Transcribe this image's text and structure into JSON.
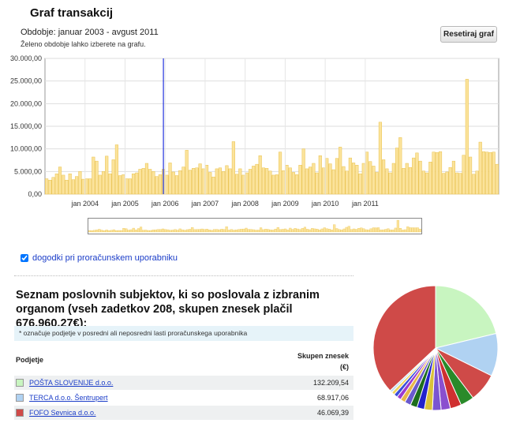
{
  "page": {
    "title": "Graf transakcij",
    "period": "Obdobje: januar 2003 - avgust 2011",
    "hint": "Želeno obdobje lahko izberete na grafu.",
    "reset_label": "Resetiraj graf",
    "checkbox_label": "dogodki pri proračunskem uporabniku",
    "list_heading": "Seznam poslovnih subjektov, ki so poslovala z izbranim organom (vseh zadetkov 208, skupen znesek plačil 676.960,27€):",
    "note": "* označuje podjetje v posredni ali neposredni lasti proračunskega uporabnika",
    "col_company": "Podjetje",
    "col_amount_line1": "Skupen znesek",
    "col_amount_line2": "(€)"
  },
  "rows": [
    {
      "name": "POŠTA SLOVENIJE d.o.o.",
      "amount": "132.209,54",
      "color": "#c8f5c0"
    },
    {
      "name": "TERCA d.o.o. Šentrupert",
      "amount": "68.917,06",
      "color": "#b0d2f2"
    },
    {
      "name": "FOFO Sevnica d.o.o.",
      "amount": "46.069,39",
      "color": "#cf4a48"
    }
  ],
  "chart_data": {
    "type": "bar",
    "x_start": "2003-01",
    "xtick_labels": [
      "jan 2004",
      "jan 2005",
      "jan 2006",
      "jan 2007",
      "jan 2008",
      "jan 2009",
      "jan 2010",
      "jan 2011"
    ],
    "ytick_labels": [
      "0,00",
      "5.000,00",
      "10.000,00",
      "15.000,00",
      "20.000,00",
      "25.000,00",
      "30.000,00"
    ],
    "ylim": [
      0,
      30000
    ],
    "grid": true,
    "bar_color": "#fbe39b",
    "bar_edge": "#e9c04a",
    "marker_month": "2005-12",
    "marker_color": "#2233dd",
    "values": [
      3400,
      3100,
      3700,
      4500,
      6000,
      4200,
      3100,
      4500,
      3200,
      3900,
      5000,
      3300,
      3400,
      3400,
      8200,
      7300,
      4200,
      5000,
      8400,
      4500,
      7600,
      10900,
      4100,
      4300,
      3400,
      3400,
      4500,
      4700,
      5500,
      5700,
      6800,
      5500,
      5000,
      3900,
      4300,
      5500,
      4200,
      6900,
      4900,
      4100,
      5200,
      6000,
      9700,
      5300,
      5700,
      5800,
      6700,
      5600,
      6400,
      4800,
      3800,
      5600,
      5800,
      5000,
      6300,
      5600,
      11600,
      4400,
      5600,
      4200,
      4700,
      5500,
      6200,
      6600,
      8500,
      5800,
      5700,
      5100,
      4200,
      4300,
      9300,
      5200,
      6400,
      5800,
      4800,
      4300,
      6400,
      10000,
      5600,
      6000,
      6800,
      4700,
      8500,
      5800,
      7900,
      6700,
      5400,
      7900,
      10400,
      6100,
      5100,
      8000,
      6900,
      6400,
      4500,
      6800,
      9300,
      7200,
      6200,
      4800,
      15900,
      7600,
      5600,
      4700,
      6800,
      10200,
      12500,
      5700,
      6800,
      5900,
      8000,
      9100,
      7300,
      5100,
      4700,
      7100,
      9300,
      9200,
      9400,
      4600,
      4900,
      5900,
      7300,
      4700,
      4600,
      8600,
      25400,
      8200,
      4400,
      5100,
      11500,
      9400,
      9300,
      9200,
      9300,
      6600
    ],
    "pie_colors": [
      "#c8f5c0",
      "#b0d2f2",
      "#cf4a48",
      "#2a8a2a",
      "#cf3030",
      "#8a4fcf",
      "#7a55d2",
      "#d9c23a",
      "#2222cc",
      "#1d6e1d",
      "#6a5acd",
      "#e7b84a",
      "#9c3bd0",
      "#3c4fd8",
      "#f0d55b",
      "#c2e0f7"
    ],
    "pie_values": [
      132.2,
      68.9,
      46.1,
      22,
      18,
      15,
      14,
      13,
      12,
      11,
      10,
      8,
      7,
      6,
      5,
      4,
      230
    ]
  }
}
